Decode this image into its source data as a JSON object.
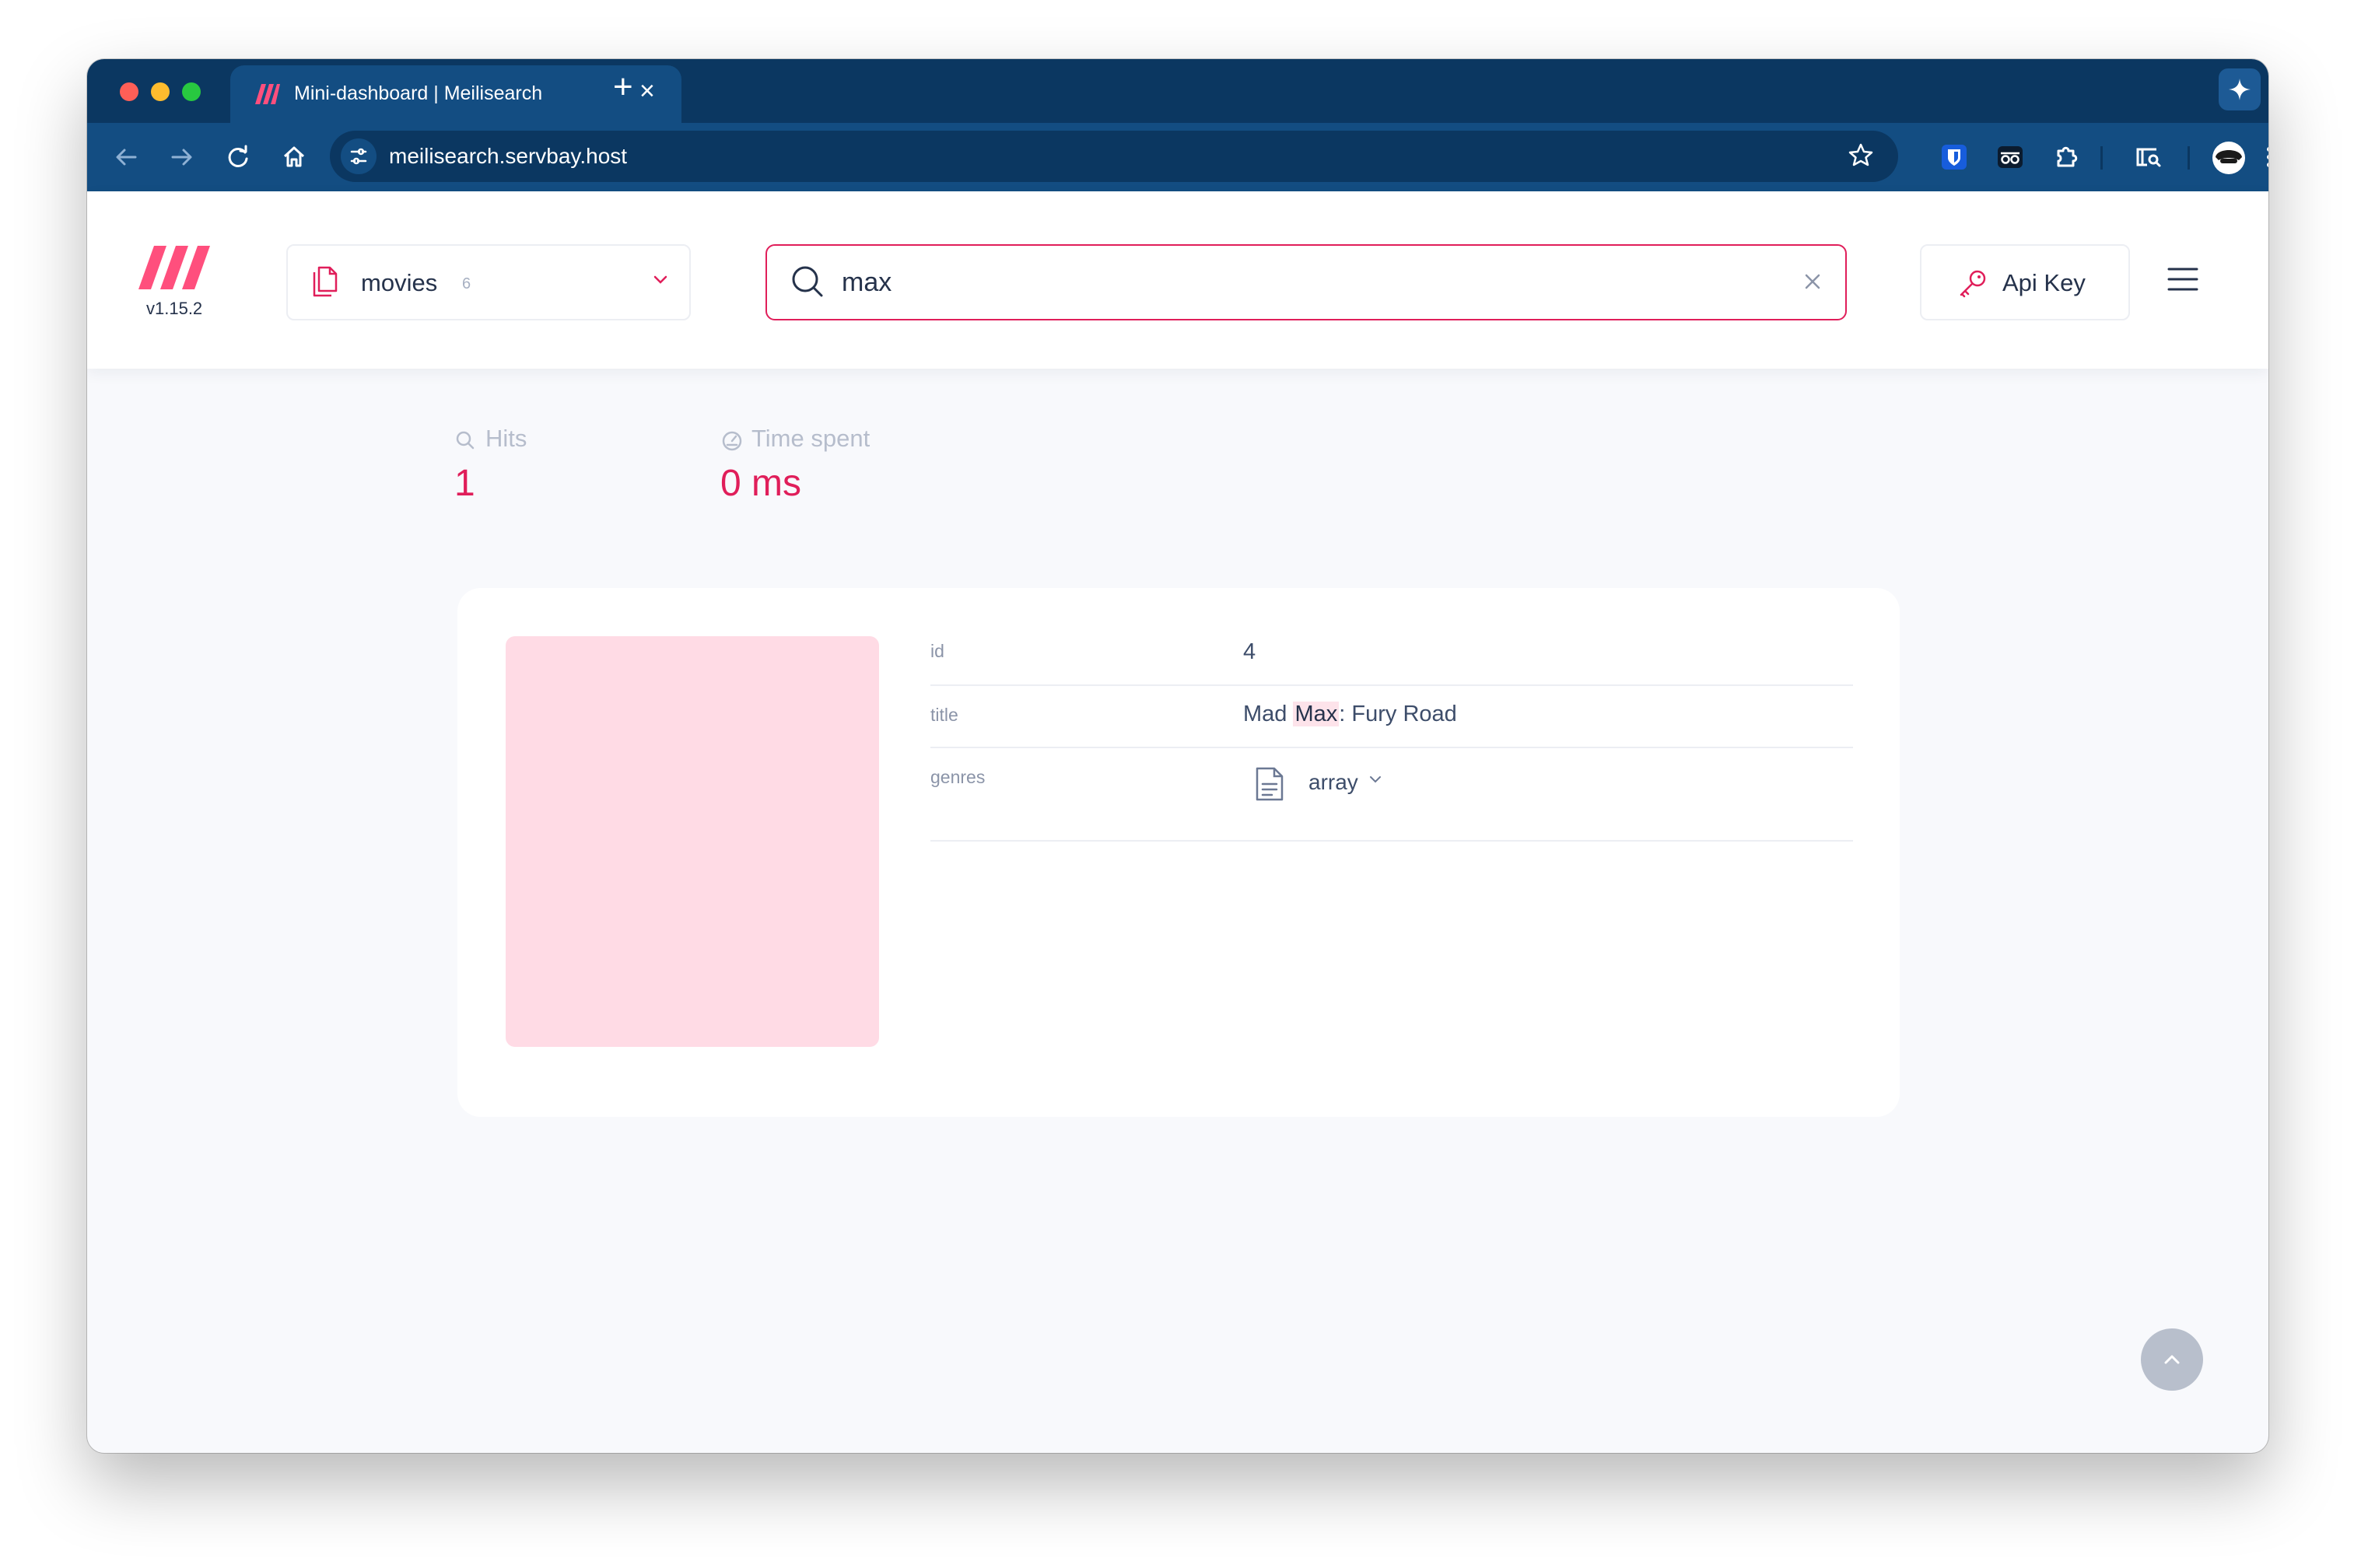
{
  "browser": {
    "tab_title": "Mini-dashboard | Meilisearch",
    "url": "meilisearch.servbay.host"
  },
  "header": {
    "version": "v1.15.2",
    "index": {
      "name": "movies",
      "count": "6"
    },
    "search": {
      "value": "max"
    },
    "api_key_label": "Api Key"
  },
  "stats": {
    "hits_label": "Hits",
    "hits_value": "1",
    "time_label": "Time spent",
    "time_value": "0 ms"
  },
  "result": {
    "fields": [
      {
        "key": "id",
        "value": "4"
      },
      {
        "key": "title",
        "value_before": "Mad ",
        "value_highlight": "Max",
        "value_after": ": Fury Road"
      },
      {
        "key": "genres",
        "value": "array"
      }
    ]
  },
  "colors": {
    "accent": "#e01e5a",
    "chrome_dark": "#0b3761",
    "chrome_light": "#134d82",
    "thumb_placeholder": "#ffdbe5"
  }
}
